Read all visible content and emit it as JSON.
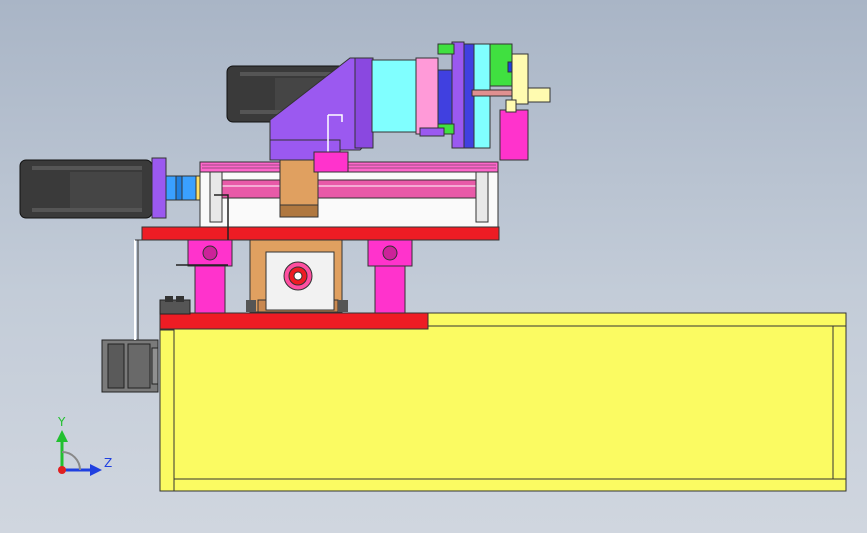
{
  "viewport": {
    "background_top": "#a9b5c6",
    "background_bottom": "#d0d6df"
  },
  "triad": {
    "y_label": "Y",
    "z_label": "Z",
    "y_color": "#22c030",
    "z_color": "#2040e0",
    "origin_color": "#e02020"
  },
  "colors": {
    "yellow_base": "#fbfb62",
    "red_plate": "#ee1c24",
    "magenta": "#ff33cc",
    "pink_rod": "#e85aa8",
    "purple": "#9b59f0",
    "cyan": "#80ffff",
    "motor_dark": "#3a3a3a",
    "orange": "#e0a060",
    "green": "#40e040",
    "blue_coupling": "#3aa0ff"
  },
  "components": [
    "base-frame",
    "lower-red-plate",
    "upper-red-plate",
    "horizontal-servo-motor",
    "upper-servo-motor",
    "angle-gearbox",
    "ball-screw",
    "linear-guide-blocks",
    "bearing-housing",
    "gripper-head",
    "small-motor"
  ]
}
